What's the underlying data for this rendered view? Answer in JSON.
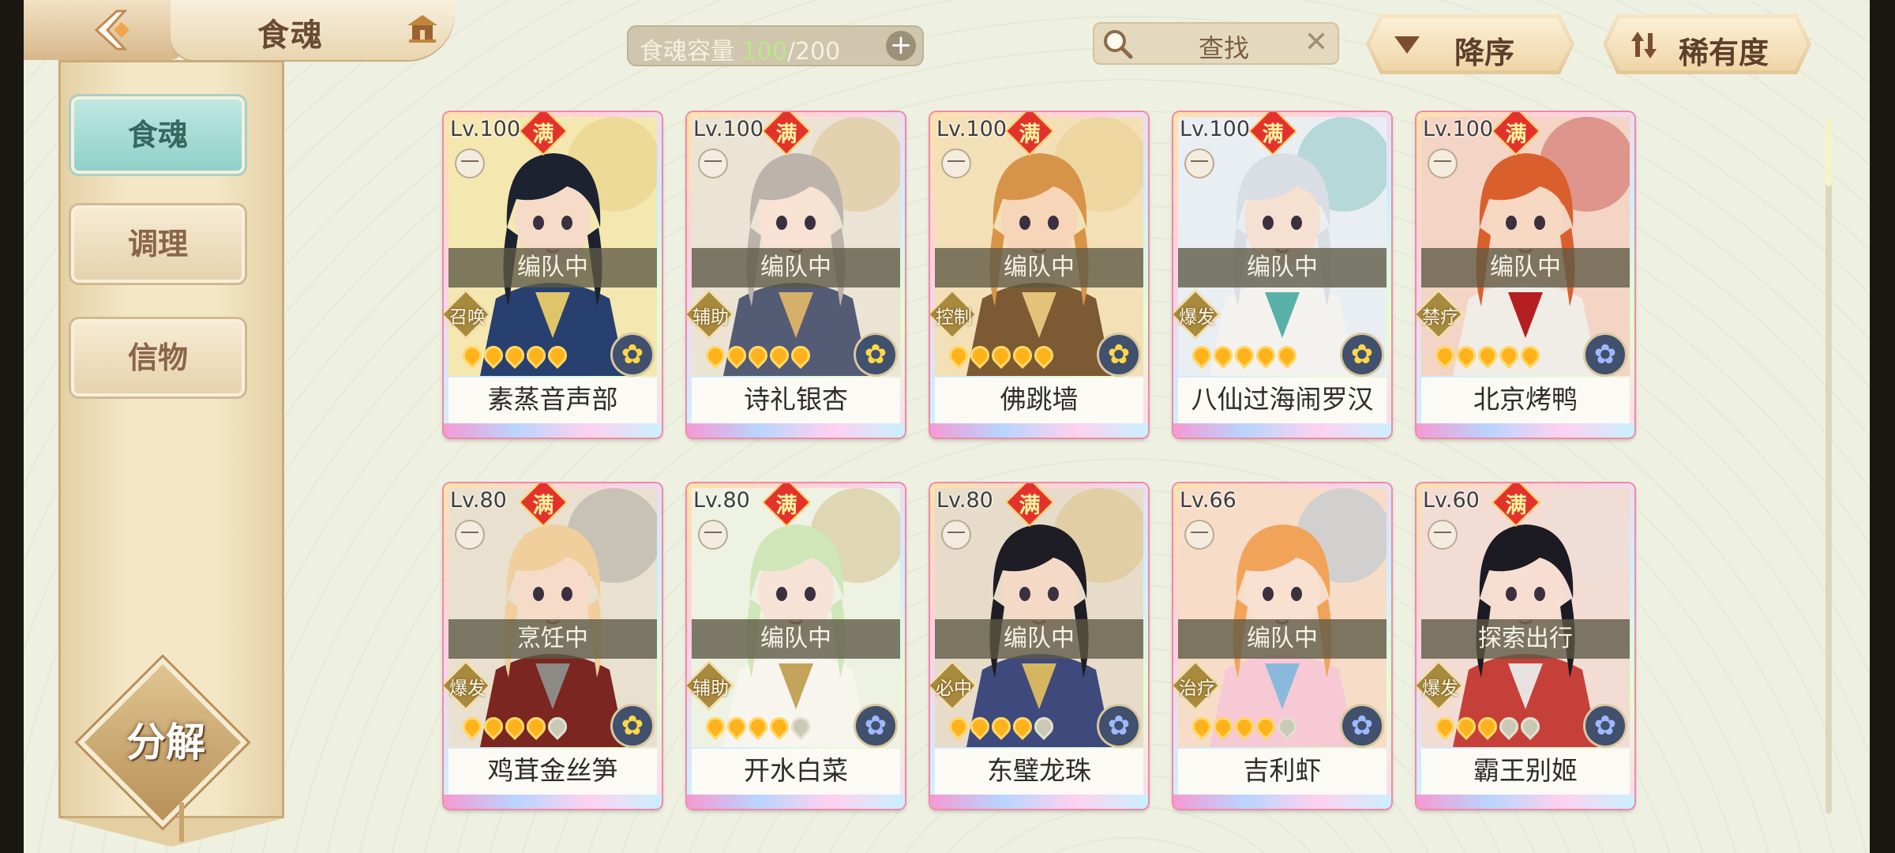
{
  "header": {
    "title": "食魂",
    "capacity": {
      "label": "食魂容量",
      "current": "100",
      "separator": "/",
      "max": "200",
      "add_icon": "plus-icon"
    },
    "search": {
      "placeholder": "查找",
      "icon": "search-icon",
      "clear_icon": "close-icon"
    },
    "sort_order": {
      "label": "降序",
      "icon": "triangle-down-icon"
    },
    "sort_key": {
      "label": "稀有度",
      "icon": "sort-arrows-icon"
    }
  },
  "sidebar": {
    "tabs": [
      {
        "label": "食魂",
        "active": true
      },
      {
        "label": "调理",
        "active": false
      },
      {
        "label": "信物",
        "active": false
      }
    ],
    "decompose_label": "分解"
  },
  "scrollbar": {
    "position_fraction": 0.0
  },
  "cards": [
    {
      "level": "Lv.100",
      "full": "满",
      "rank": "一",
      "status": "编队中",
      "role": "召唤",
      "fire_lit": 5,
      "fire_total": 5,
      "element": "gold",
      "name": "素蒸音声部"
    },
    {
      "level": "Lv.100",
      "full": "满",
      "rank": "一",
      "status": "编队中",
      "role": "辅助",
      "fire_lit": 5,
      "fire_total": 5,
      "element": "gold",
      "name": "诗礼银杏"
    },
    {
      "level": "Lv.100",
      "full": "满",
      "rank": "一",
      "status": "编队中",
      "role": "控制",
      "fire_lit": 5,
      "fire_total": 5,
      "element": "gold",
      "name": "佛跳墙"
    },
    {
      "level": "Lv.100",
      "full": "满",
      "rank": "一",
      "status": "编队中",
      "role": "爆发",
      "fire_lit": 5,
      "fire_total": 5,
      "element": "gold",
      "name": "八仙过海闹罗汉"
    },
    {
      "level": "Lv.100",
      "full": "满",
      "rank": "一",
      "status": "编队中",
      "role": "禁疗",
      "fire_lit": 5,
      "fire_total": 5,
      "element": "blue",
      "name": "北京烤鸭"
    },
    {
      "level": "Lv.80",
      "full": "满",
      "rank": "一",
      "status": "烹饪中",
      "role": "爆发",
      "fire_lit": 4,
      "fire_total": 5,
      "element": "gold",
      "name": "鸡茸金丝笋"
    },
    {
      "level": "Lv.80",
      "full": "满",
      "rank": "一",
      "status": "编队中",
      "role": "辅助",
      "fire_lit": 4,
      "fire_total": 5,
      "element": "blue",
      "name": "开水白菜"
    },
    {
      "level": "Lv.80",
      "full": "满",
      "rank": "一",
      "status": "编队中",
      "role": "必中",
      "fire_lit": 4,
      "fire_total": 5,
      "element": "blue",
      "name": "东璧龙珠"
    },
    {
      "level": "Lv.66",
      "full": "",
      "rank": "一",
      "status": "编队中",
      "role": "治疗",
      "fire_lit": 4,
      "fire_total": 5,
      "element": "blue",
      "name": "吉利虾"
    },
    {
      "level": "Lv.60",
      "full": "满",
      "rank": "一",
      "status": "探索出行",
      "role": "爆发",
      "fire_lit": 3,
      "fire_total": 5,
      "element": "blue",
      "name": "霸王别姬"
    }
  ],
  "portrait_palettes": [
    {
      "bg": "#f4e7b0",
      "hair": "#1c2230",
      "skin": "#f6dcc8",
      "robe": "#27406f",
      "accent": "#e0c46a"
    },
    {
      "bg": "#ebe4d4",
      "hair": "#bcb3aa",
      "skin": "#f7e2d4",
      "robe": "#545b74",
      "accent": "#d5b06a"
    },
    {
      "bg": "#f3e0b6",
      "hair": "#d79448",
      "skin": "#f6d5b9",
      "robe": "#7b5a34",
      "accent": "#e4c27a"
    },
    {
      "bg": "#e9eef2",
      "hair": "#d9dde4",
      "skin": "#f5e0d2",
      "robe": "#f4f2ee",
      "accent": "#59b0a8"
    },
    {
      "bg": "#f4d4c4",
      "hair": "#d9602c",
      "skin": "#f7d8c2",
      "robe": "#f0ece6",
      "accent": "#b51f22"
    },
    {
      "bg": "#e9e0cf",
      "hair": "#f1cf9c",
      "skin": "#f6dcc8",
      "robe": "#7b2620",
      "accent": "#8d8a86"
    },
    {
      "bg": "#eef2e3",
      "hair": "#cfe6b9",
      "skin": "#f7e3d6",
      "robe": "#f8f5ef",
      "accent": "#c4a35a"
    },
    {
      "bg": "#e6dcc9",
      "hair": "#1e1c24",
      "skin": "#f3d9c6",
      "robe": "#3e4a7c",
      "accent": "#d6b561"
    },
    {
      "bg": "#f7dcc8",
      "hair": "#f2a35a",
      "skin": "#f9e1d1",
      "robe": "#f6c9d4",
      "accent": "#89b9dc"
    },
    {
      "bg": "#f2dcd3",
      "hair": "#1c1a22",
      "skin": "#f7ded1",
      "robe": "#c6403a",
      "accent": "#e7e2e0"
    }
  ]
}
